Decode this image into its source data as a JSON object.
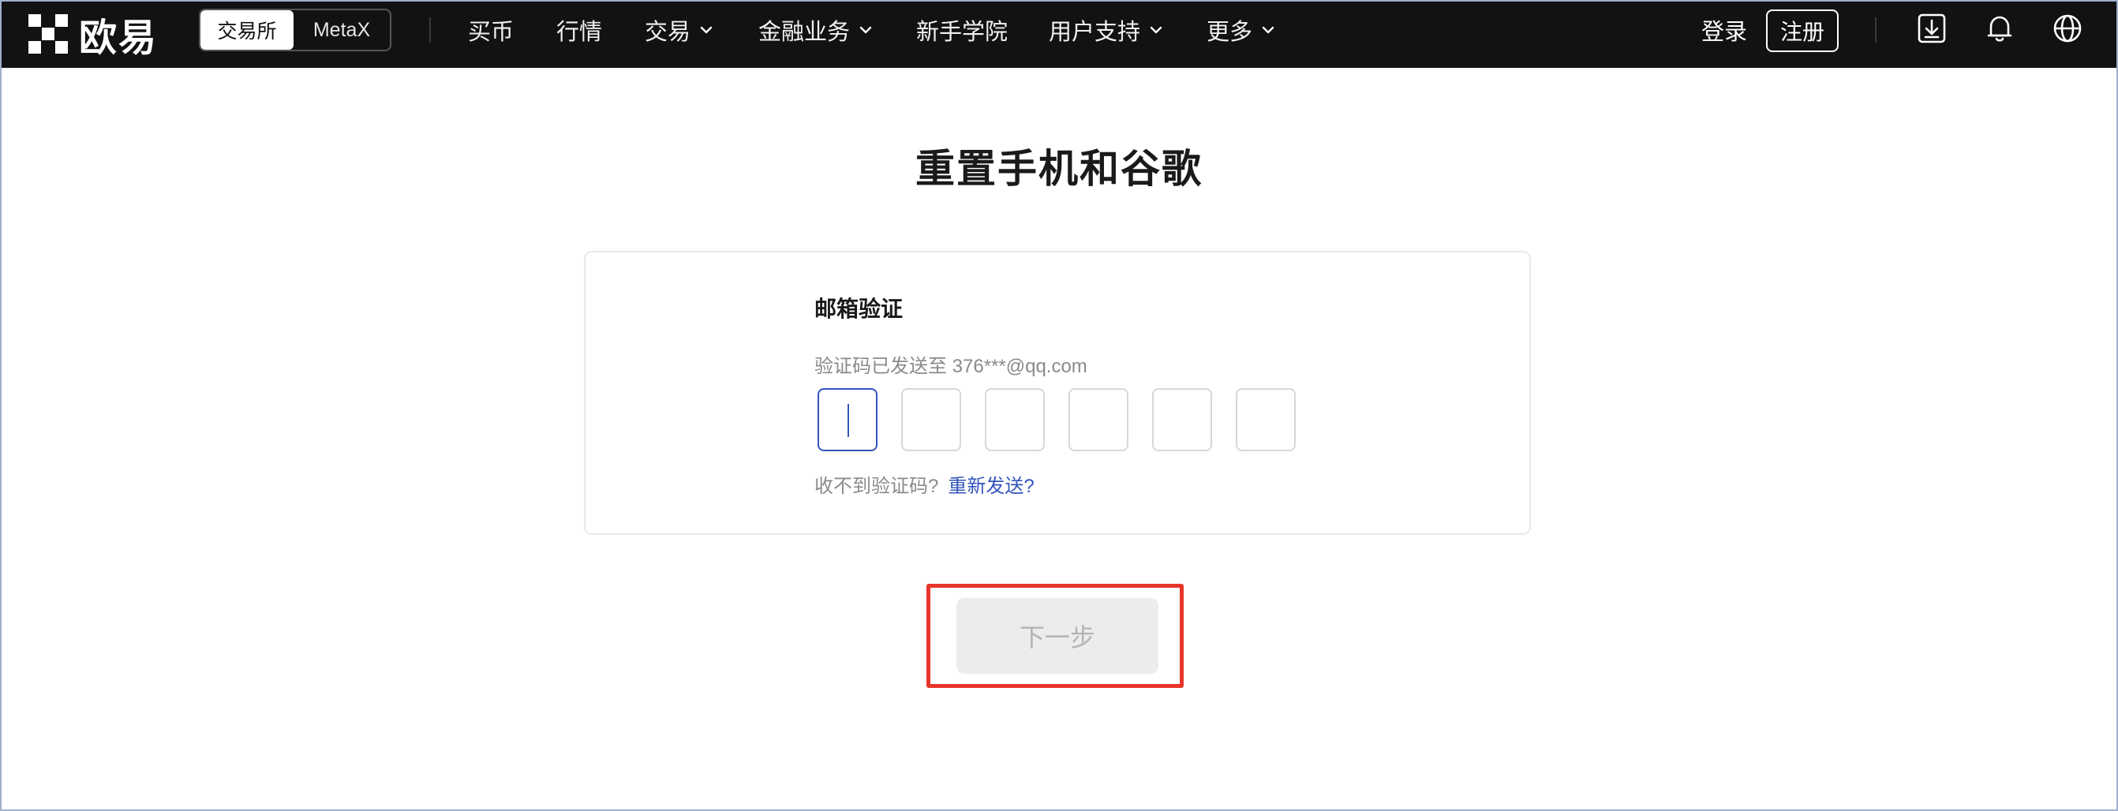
{
  "brand": {
    "name": "欧易"
  },
  "header": {
    "segments": [
      "交易所",
      "MetaX"
    ],
    "nav": [
      {
        "label": "买币",
        "dropdown": false
      },
      {
        "label": "行情",
        "dropdown": false
      },
      {
        "label": "交易",
        "dropdown": true
      },
      {
        "label": "金融业务",
        "dropdown": true
      },
      {
        "label": "新手学院",
        "dropdown": false
      },
      {
        "label": "用户支持",
        "dropdown": true
      },
      {
        "label": "更多",
        "dropdown": true
      }
    ],
    "login": "登录",
    "register": "注册",
    "icons": [
      "download-icon",
      "bell-icon",
      "globe-icon"
    ]
  },
  "main": {
    "title": "重置手机和谷歌",
    "card": {
      "heading": "邮箱验证",
      "subtext": "验证码已发送至 376***@qq.com",
      "code_length": 6,
      "resend_prompt": "收不到验证码?",
      "resend_link": "重新发送?"
    },
    "next_button": "下一步"
  },
  "colors": {
    "nav_bg": "#121212",
    "accent": "#3355bb",
    "highlight": "#e8352a",
    "disabled_bg": "#ececec"
  }
}
